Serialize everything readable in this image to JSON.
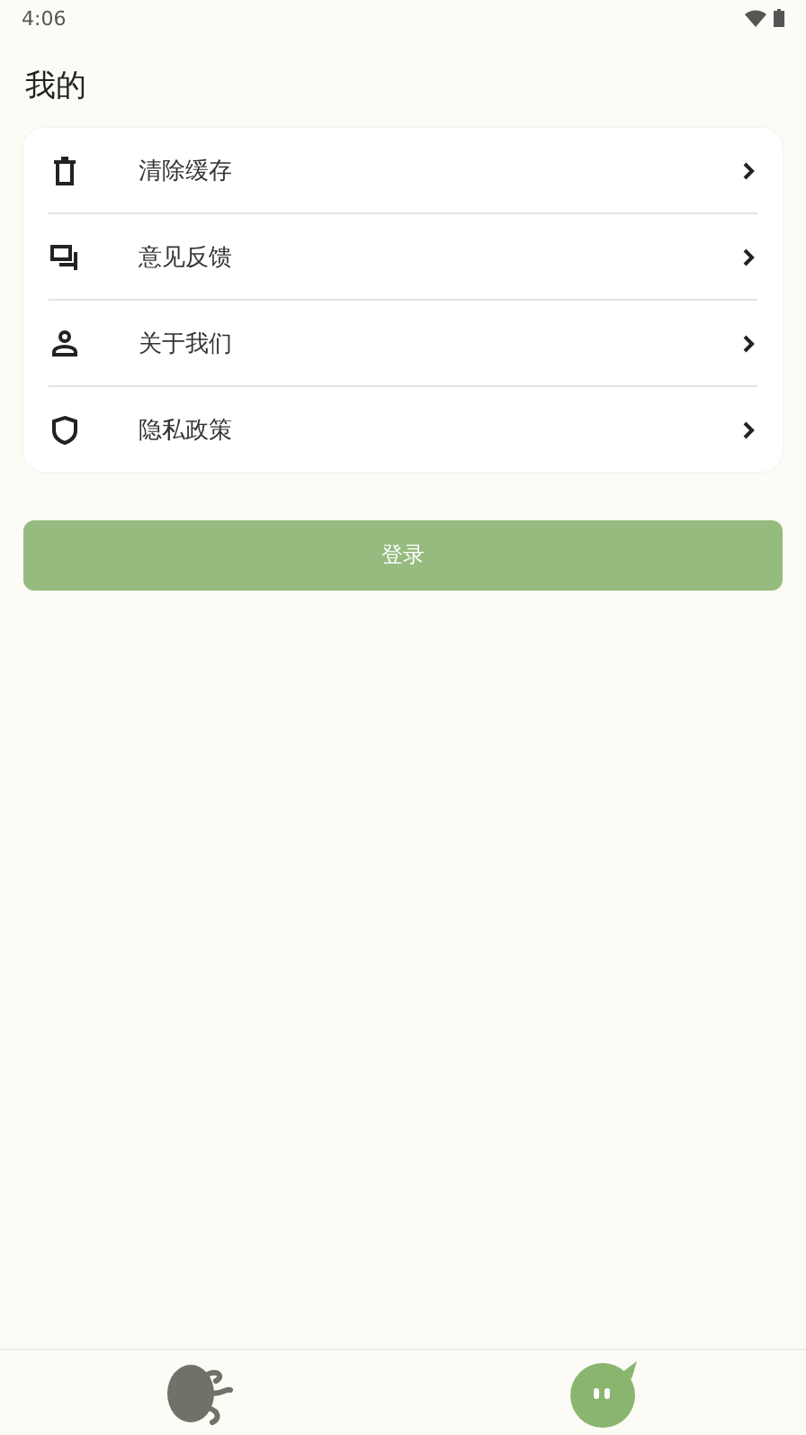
{
  "status_bar": {
    "time": "4:06"
  },
  "title": "我的",
  "menu": [
    {
      "label": "清除缓存",
      "kind": "trash"
    },
    {
      "label": "意见反馈",
      "kind": "feedback"
    },
    {
      "label": "关于我们",
      "kind": "person"
    },
    {
      "label": "隐私政策",
      "kind": "shield"
    }
  ],
  "login_button": "登录",
  "bottom_nav": [
    {
      "kind": "octopus",
      "selected": false
    },
    {
      "kind": "blob",
      "selected": true
    }
  ]
}
